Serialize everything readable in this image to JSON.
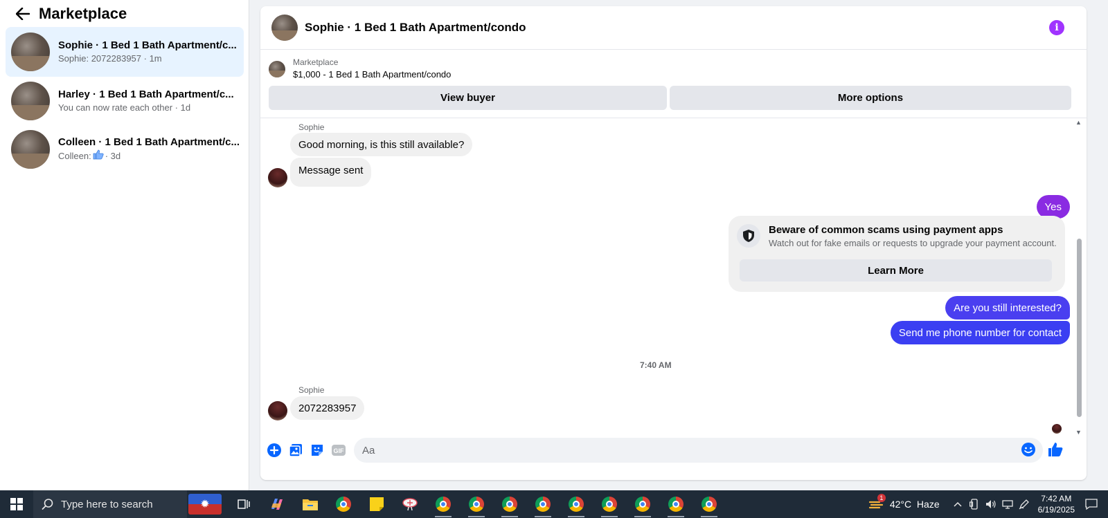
{
  "sidebar": {
    "title": "Marketplace",
    "conversations": [
      {
        "title": "Sophie · 1 Bed 1 Bath Apartment/c...",
        "preview": "Sophie: 2072283957",
        "time": "· 1m"
      },
      {
        "title": "Harley · 1 Bed 1 Bath Apartment/c...",
        "preview": "You can now rate each other",
        "time": "· 1d"
      },
      {
        "title": "Colleen · 1 Bed 1 Bath Apartment/c...",
        "preview": "Colleen:",
        "time": "· 3d"
      }
    ]
  },
  "chat": {
    "title": "Sophie · 1 Bed 1 Bath Apartment/condo",
    "listing": {
      "source": "Marketplace",
      "price_title": "$1,000 - 1 Bed 1 Bath Apartment/condo",
      "view_buyer_label": "View buyer",
      "more_options_label": "More options"
    },
    "messages": {
      "sender1": "Sophie",
      "m1": "Good morning, is this still available?",
      "m2": "Message sent",
      "m3": "Yes",
      "m4": "Are you still interested?",
      "m5": "Send me phone number for contact",
      "timestamp": "7:40 AM",
      "sender2": "Sophie",
      "m6": "2072283957"
    },
    "scam_notice": {
      "title": "Beware of common scams using payment apps",
      "text": "Watch out for fake emails or requests to upgrade your payment account.",
      "button_label": "Learn More"
    },
    "composer": {
      "placeholder": "Aa"
    }
  },
  "colors": {
    "accent": "#0866ff",
    "out_bubble_purple": "#8a2be2",
    "out_bubble_blue": "#3b3ff2",
    "info_purple": "#a033ff"
  },
  "taskbar": {
    "search_placeholder": "Type here to search",
    "weather": "42°C  Haze",
    "weather_badge": "1",
    "time": "7:42 AM",
    "date": "6/19/2025"
  }
}
